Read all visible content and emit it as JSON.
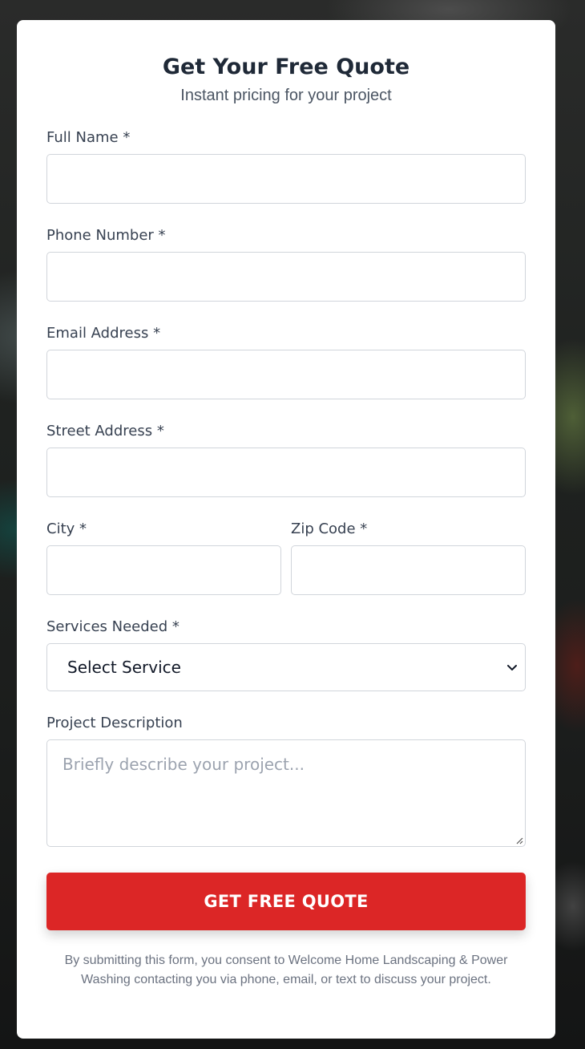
{
  "form": {
    "title": "Get Your Free Quote",
    "subtitle": "Instant pricing for your project",
    "fields": {
      "full_name": {
        "label": "Full Name *",
        "value": ""
      },
      "phone": {
        "label": "Phone Number *",
        "value": ""
      },
      "email": {
        "label": "Email Address *",
        "value": ""
      },
      "street": {
        "label": "Street Address *",
        "value": ""
      },
      "city": {
        "label": "City *",
        "value": ""
      },
      "zip": {
        "label": "Zip Code *",
        "value": ""
      },
      "services": {
        "label": "Services Needed *",
        "selected": "Select Service"
      },
      "description": {
        "label": "Project Description",
        "placeholder": "Briefly describe your project..."
      }
    },
    "submit_label": "GET FREE QUOTE",
    "consent_text": "By submitting this form, you consent to Welcome Home Landscaping & Power Washing contacting you via phone, email, or text to discuss your project."
  },
  "icons": {
    "select_arrow": "chevron-down-icon",
    "textarea_grip": "resize-grip-icon"
  },
  "colors": {
    "accent": "#dc2626",
    "heading": "#1f2937",
    "label": "#374151",
    "muted": "#6b7280",
    "border": "#d1d5db"
  }
}
